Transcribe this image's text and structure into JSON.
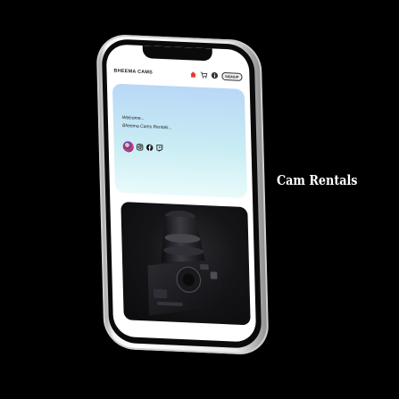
{
  "app": {
    "brand": "BHEEMA CAMS",
    "signup_label": "SIGNUP"
  },
  "hero": {
    "line1": "Welcome...",
    "line2": "Bheema Cams Rentals..."
  },
  "icons": {
    "nav": [
      "home-icon",
      "cart-icon",
      "info-icon"
    ],
    "social": [
      "instagram-icon",
      "facebook-icon",
      "twitch-icon"
    ]
  },
  "caption": "Cam Rentals",
  "colors": {
    "background": "#000000",
    "home_icon": "#e53935",
    "hero_top": "#b8d8f6",
    "hero_bottom": "#e9fbfb"
  }
}
